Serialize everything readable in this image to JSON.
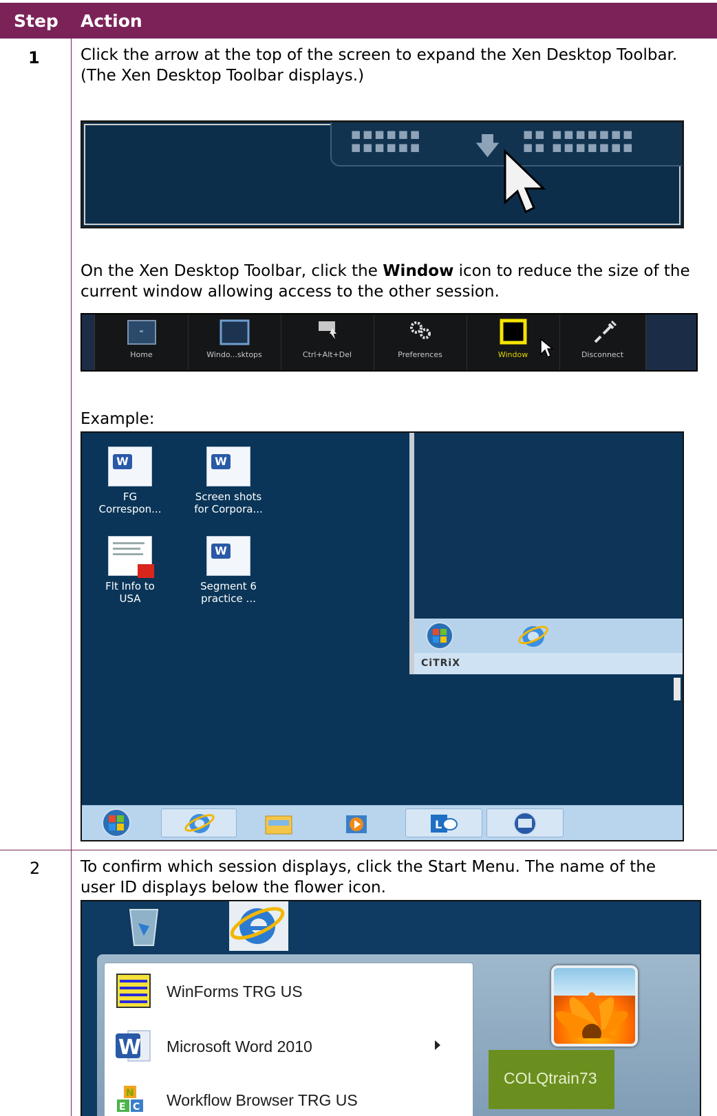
{
  "header": {
    "step": "Step",
    "action": "Action"
  },
  "rows": [
    {
      "step": "1",
      "instructions": [
        "Click the arrow at the top of the screen to expand the Xen Desktop Toolbar.",
        "(The Xen Desktop Toolbar displays.)"
      ],
      "window_instruction": {
        "before": "On the Xen Desktop Toolbar, click the ",
        "bold": "Window",
        "after": " icon to reduce the size of the",
        "line2": "current window allowing access to the other session."
      },
      "toolbar_buttons": [
        "Home",
        "Windo...sktops",
        "Ctrl+Alt+Del",
        "Preferences",
        "Window",
        "Disconnect"
      ],
      "example_label": "Example:",
      "desktop_icons": [
        {
          "line1": "FG",
          "line2": "Correspon..."
        },
        {
          "line1": "Screen shots",
          "line2": "for Corpora..."
        },
        {
          "line1": "Flt Info to",
          "line2": "USA"
        },
        {
          "line1": "Segment 6",
          "line2": "practice ..."
        }
      ],
      "session_brand": "CiTRiX"
    },
    {
      "step": "2",
      "instructions": [
        "To confirm which session displays, click the Start Menu. The name of the",
        "user ID displays below the flower icon."
      ],
      "start_menu_items": [
        "WinForms TRG US",
        "Microsoft Word 2010",
        "Workflow Browser TRG US"
      ],
      "user_id": "COLQtrain73"
    }
  ],
  "colors": {
    "header_bg": "#7b2359",
    "desktop_bg": "#0a3558",
    "user_box": "#6b8f1f"
  }
}
